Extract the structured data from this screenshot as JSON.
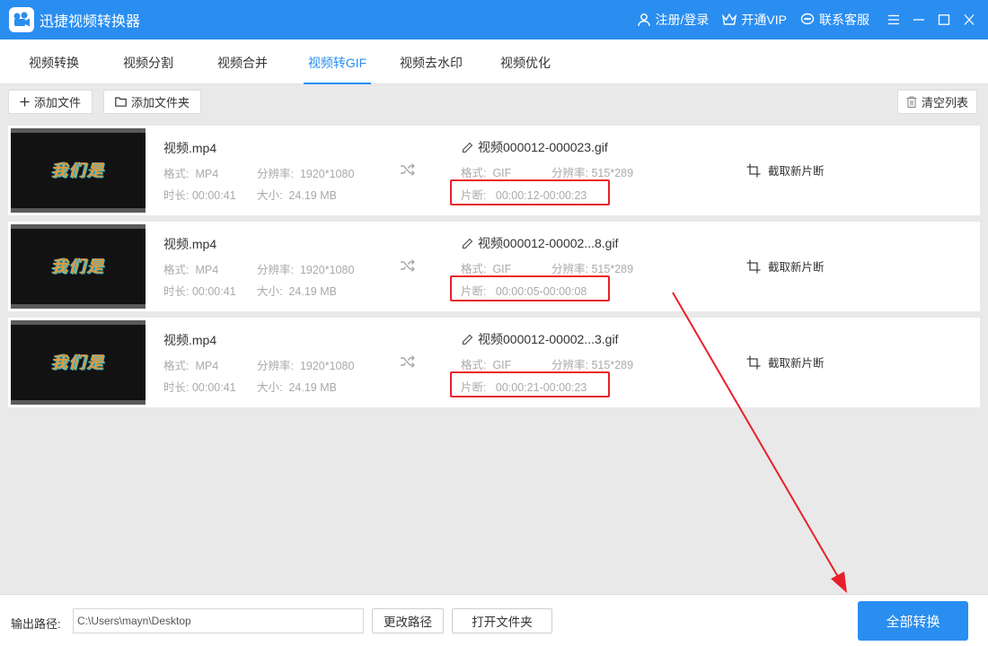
{
  "app": {
    "title": "迅捷视频转换器"
  },
  "titlebar": {
    "login": "注册/登录",
    "vip": "开通VIP",
    "support": "联系客服"
  },
  "tabs": [
    {
      "label": "视频转换",
      "active": false
    },
    {
      "label": "视频分割",
      "active": false
    },
    {
      "label": "视频合并",
      "active": false
    },
    {
      "label": "视频转GIF",
      "active": true
    },
    {
      "label": "视频去水印",
      "active": false
    },
    {
      "label": "视频优化",
      "active": false
    }
  ],
  "toolbar": {
    "add_file": "添加文件",
    "add_folder": "添加文件夹",
    "clear_list": "清空列表"
  },
  "labels": {
    "format": "格式:",
    "resolution": "分辨率:",
    "duration": "时长:",
    "size": "大小:",
    "clip": "片断:",
    "clip_action": "截取新片断"
  },
  "files": [
    {
      "thumb_text": "我们是",
      "source_name": "视频.mp4",
      "source_format": "MP4",
      "source_resolution": "1920*1080",
      "source_duration": "00:00:41",
      "source_size": "24.19 MB",
      "output_name": "视频000012-000023.gif",
      "output_format": "GIF",
      "output_resolution": "515*289",
      "clip_range": "00:00:12-00:00:23"
    },
    {
      "thumb_text": "我们是",
      "source_name": "视频.mp4",
      "source_format": "MP4",
      "source_resolution": "1920*1080",
      "source_duration": "00:00:41",
      "source_size": "24.19 MB",
      "output_name": "视频000012-00002...8.gif",
      "output_format": "GIF",
      "output_resolution": "515*289",
      "clip_range": "00:00:05-00:00:08"
    },
    {
      "thumb_text": "我们是",
      "source_name": "视频.mp4",
      "source_format": "MP4",
      "source_resolution": "1920*1080",
      "source_duration": "00:00:41",
      "source_size": "24.19 MB",
      "output_name": "视频000012-00002...3.gif",
      "output_format": "GIF",
      "output_resolution": "515*289",
      "clip_range": "00:00:21-00:00:23"
    }
  ],
  "bottom": {
    "output_path_label": "输出路径:",
    "output_path_value": "C:\\Users\\mayn\\Desktop",
    "change_path": "更改路径",
    "open_folder": "打开文件夹",
    "convert_all": "全部转换"
  },
  "colors": {
    "accent": "#2a8ef0",
    "annotation": "#e8202a"
  }
}
